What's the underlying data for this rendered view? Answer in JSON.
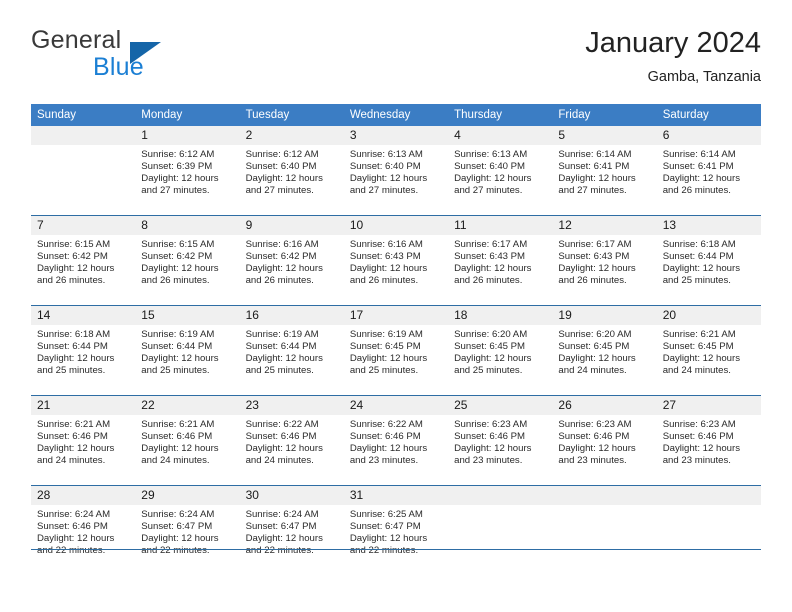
{
  "brand": {
    "name_part1": "General",
    "name_part2": "Blue",
    "triangle_icon": "triangle-logo",
    "color_dark": "#3a3a3a",
    "color_blue": "#1b7fd4"
  },
  "header": {
    "title": "January 2024",
    "subtitle": "Gamba, Tanzania"
  },
  "theme": {
    "header_bg": "#3b7dc4",
    "border": "#2e6da4",
    "daynum_bg": "#f0f0f0"
  },
  "calendar": {
    "weekday_headers": [
      "Sunday",
      "Monday",
      "Tuesday",
      "Wednesday",
      "Thursday",
      "Friday",
      "Saturday"
    ],
    "weeks": [
      [
        {
          "day": "",
          "empty": true,
          "sunrise": "",
          "sunset": "",
          "daylight_line1": "",
          "daylight_line2": ""
        },
        {
          "day": "1",
          "sunrise": "Sunrise: 6:12 AM",
          "sunset": "Sunset: 6:39 PM",
          "daylight_line1": "Daylight: 12 hours",
          "daylight_line2": "and 27 minutes."
        },
        {
          "day": "2",
          "sunrise": "Sunrise: 6:12 AM",
          "sunset": "Sunset: 6:40 PM",
          "daylight_line1": "Daylight: 12 hours",
          "daylight_line2": "and 27 minutes."
        },
        {
          "day": "3",
          "sunrise": "Sunrise: 6:13 AM",
          "sunset": "Sunset: 6:40 PM",
          "daylight_line1": "Daylight: 12 hours",
          "daylight_line2": "and 27 minutes."
        },
        {
          "day": "4",
          "sunrise": "Sunrise: 6:13 AM",
          "sunset": "Sunset: 6:40 PM",
          "daylight_line1": "Daylight: 12 hours",
          "daylight_line2": "and 27 minutes."
        },
        {
          "day": "5",
          "sunrise": "Sunrise: 6:14 AM",
          "sunset": "Sunset: 6:41 PM",
          "daylight_line1": "Daylight: 12 hours",
          "daylight_line2": "and 27 minutes."
        },
        {
          "day": "6",
          "sunrise": "Sunrise: 6:14 AM",
          "sunset": "Sunset: 6:41 PM",
          "daylight_line1": "Daylight: 12 hours",
          "daylight_line2": "and 26 minutes."
        }
      ],
      [
        {
          "day": "7",
          "sunrise": "Sunrise: 6:15 AM",
          "sunset": "Sunset: 6:42 PM",
          "daylight_line1": "Daylight: 12 hours",
          "daylight_line2": "and 26 minutes."
        },
        {
          "day": "8",
          "sunrise": "Sunrise: 6:15 AM",
          "sunset": "Sunset: 6:42 PM",
          "daylight_line1": "Daylight: 12 hours",
          "daylight_line2": "and 26 minutes."
        },
        {
          "day": "9",
          "sunrise": "Sunrise: 6:16 AM",
          "sunset": "Sunset: 6:42 PM",
          "daylight_line1": "Daylight: 12 hours",
          "daylight_line2": "and 26 minutes."
        },
        {
          "day": "10",
          "sunrise": "Sunrise: 6:16 AM",
          "sunset": "Sunset: 6:43 PM",
          "daylight_line1": "Daylight: 12 hours",
          "daylight_line2": "and 26 minutes."
        },
        {
          "day": "11",
          "sunrise": "Sunrise: 6:17 AM",
          "sunset": "Sunset: 6:43 PM",
          "daylight_line1": "Daylight: 12 hours",
          "daylight_line2": "and 26 minutes."
        },
        {
          "day": "12",
          "sunrise": "Sunrise: 6:17 AM",
          "sunset": "Sunset: 6:43 PM",
          "daylight_line1": "Daylight: 12 hours",
          "daylight_line2": "and 26 minutes."
        },
        {
          "day": "13",
          "sunrise": "Sunrise: 6:18 AM",
          "sunset": "Sunset: 6:44 PM",
          "daylight_line1": "Daylight: 12 hours",
          "daylight_line2": "and 25 minutes."
        }
      ],
      [
        {
          "day": "14",
          "sunrise": "Sunrise: 6:18 AM",
          "sunset": "Sunset: 6:44 PM",
          "daylight_line1": "Daylight: 12 hours",
          "daylight_line2": "and 25 minutes."
        },
        {
          "day": "15",
          "sunrise": "Sunrise: 6:19 AM",
          "sunset": "Sunset: 6:44 PM",
          "daylight_line1": "Daylight: 12 hours",
          "daylight_line2": "and 25 minutes."
        },
        {
          "day": "16",
          "sunrise": "Sunrise: 6:19 AM",
          "sunset": "Sunset: 6:44 PM",
          "daylight_line1": "Daylight: 12 hours",
          "daylight_line2": "and 25 minutes."
        },
        {
          "day": "17",
          "sunrise": "Sunrise: 6:19 AM",
          "sunset": "Sunset: 6:45 PM",
          "daylight_line1": "Daylight: 12 hours",
          "daylight_line2": "and 25 minutes."
        },
        {
          "day": "18",
          "sunrise": "Sunrise: 6:20 AM",
          "sunset": "Sunset: 6:45 PM",
          "daylight_line1": "Daylight: 12 hours",
          "daylight_line2": "and 25 minutes."
        },
        {
          "day": "19",
          "sunrise": "Sunrise: 6:20 AM",
          "sunset": "Sunset: 6:45 PM",
          "daylight_line1": "Daylight: 12 hours",
          "daylight_line2": "and 24 minutes."
        },
        {
          "day": "20",
          "sunrise": "Sunrise: 6:21 AM",
          "sunset": "Sunset: 6:45 PM",
          "daylight_line1": "Daylight: 12 hours",
          "daylight_line2": "and 24 minutes."
        }
      ],
      [
        {
          "day": "21",
          "sunrise": "Sunrise: 6:21 AM",
          "sunset": "Sunset: 6:46 PM",
          "daylight_line1": "Daylight: 12 hours",
          "daylight_line2": "and 24 minutes."
        },
        {
          "day": "22",
          "sunrise": "Sunrise: 6:21 AM",
          "sunset": "Sunset: 6:46 PM",
          "daylight_line1": "Daylight: 12 hours",
          "daylight_line2": "and 24 minutes."
        },
        {
          "day": "23",
          "sunrise": "Sunrise: 6:22 AM",
          "sunset": "Sunset: 6:46 PM",
          "daylight_line1": "Daylight: 12 hours",
          "daylight_line2": "and 24 minutes."
        },
        {
          "day": "24",
          "sunrise": "Sunrise: 6:22 AM",
          "sunset": "Sunset: 6:46 PM",
          "daylight_line1": "Daylight: 12 hours",
          "daylight_line2": "and 23 minutes."
        },
        {
          "day": "25",
          "sunrise": "Sunrise: 6:23 AM",
          "sunset": "Sunset: 6:46 PM",
          "daylight_line1": "Daylight: 12 hours",
          "daylight_line2": "and 23 minutes."
        },
        {
          "day": "26",
          "sunrise": "Sunrise: 6:23 AM",
          "sunset": "Sunset: 6:46 PM",
          "daylight_line1": "Daylight: 12 hours",
          "daylight_line2": "and 23 minutes."
        },
        {
          "day": "27",
          "sunrise": "Sunrise: 6:23 AM",
          "sunset": "Sunset: 6:46 PM",
          "daylight_line1": "Daylight: 12 hours",
          "daylight_line2": "and 23 minutes."
        }
      ],
      [
        {
          "day": "28",
          "sunrise": "Sunrise: 6:24 AM",
          "sunset": "Sunset: 6:46 PM",
          "daylight_line1": "Daylight: 12 hours",
          "daylight_line2": "and 22 minutes."
        },
        {
          "day": "29",
          "sunrise": "Sunrise: 6:24 AM",
          "sunset": "Sunset: 6:47 PM",
          "daylight_line1": "Daylight: 12 hours",
          "daylight_line2": "and 22 minutes."
        },
        {
          "day": "30",
          "sunrise": "Sunrise: 6:24 AM",
          "sunset": "Sunset: 6:47 PM",
          "daylight_line1": "Daylight: 12 hours",
          "daylight_line2": "and 22 minutes."
        },
        {
          "day": "31",
          "sunrise": "Sunrise: 6:25 AM",
          "sunset": "Sunset: 6:47 PM",
          "daylight_line1": "Daylight: 12 hours",
          "daylight_line2": "and 22 minutes."
        },
        {
          "day": "",
          "empty": true,
          "sunrise": "",
          "sunset": "",
          "daylight_line1": "",
          "daylight_line2": ""
        },
        {
          "day": "",
          "empty": true,
          "sunrise": "",
          "sunset": "",
          "daylight_line1": "",
          "daylight_line2": ""
        },
        {
          "day": "",
          "empty": true,
          "sunrise": "",
          "sunset": "",
          "daylight_line1": "",
          "daylight_line2": ""
        }
      ]
    ]
  }
}
